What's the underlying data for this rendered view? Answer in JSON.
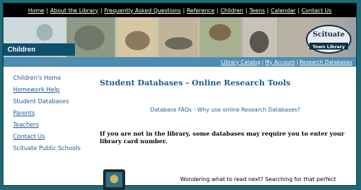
{
  "top_nav": {
    "items": [
      "Home",
      "About the Library",
      "Frequently Asked Questions",
      "Reference",
      "Children",
      "Teens",
      "Calendar",
      "Contact Us"
    ]
  },
  "banner": {
    "section_label": "Children",
    "logo": {
      "line1": "Scituate",
      "line2": "Town Library"
    }
  },
  "sub_nav": {
    "items": [
      "Library Catalog",
      "My Account",
      "Research Databases"
    ]
  },
  "sidebar": {
    "items": [
      "Children's Home",
      "Homework Help",
      "Student Databases",
      "Parents",
      "Teachers",
      "Contact Us",
      "Scituate Public Schools"
    ]
  },
  "main": {
    "title": "Student Databases - Online Research Tools",
    "faq_link": "Database FAQs - Why use online Research Databases?",
    "notice": "If you are not in the library, some databases may require you to enter your library card number.",
    "reading_teaser": "Wondering what to read next? Searching for that perfect"
  },
  "colors": {
    "page_bg": "#1b6a78",
    "topnav_bg": "#000000",
    "section_bar": "#0f4f6e",
    "subnav_bg": "#4d8cb3",
    "link": "#1d5a94"
  }
}
